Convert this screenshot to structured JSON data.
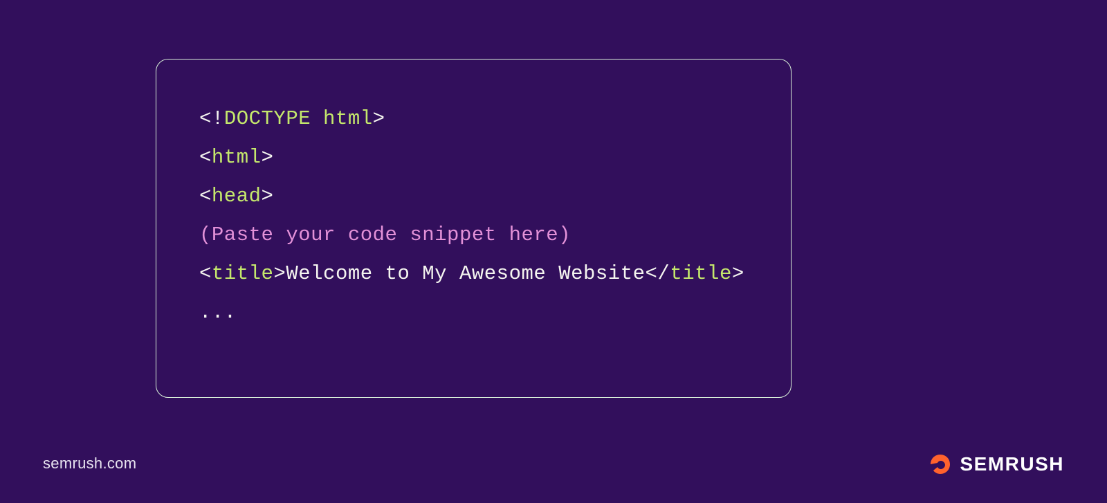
{
  "code": {
    "line1": {
      "bracket_open": "<!",
      "tag": "DOCTYPE html",
      "bracket_close": ">"
    },
    "line2": {
      "bracket_open": "<",
      "tag": "html",
      "bracket_close": ">"
    },
    "line3": {
      "bracket_open": "<",
      "tag": "head",
      "bracket_close": ">"
    },
    "line4": "(Paste your code snippet here)",
    "line5": {
      "open_bracket": "<",
      "open_tag": "title",
      "open_close": ">",
      "text": "Welcome to My Awesome Website",
      "close_bracket": "</",
      "close_tag": "title",
      "close_close": ">"
    },
    "line6": "..."
  },
  "footer": {
    "url": "semrush.com",
    "brand": "SEMRUSH"
  },
  "colors": {
    "background": "#320F5C",
    "green": "#C5E86C",
    "white": "#F5F5F0",
    "pink": "#E391D8",
    "orange": "#FF622D"
  }
}
